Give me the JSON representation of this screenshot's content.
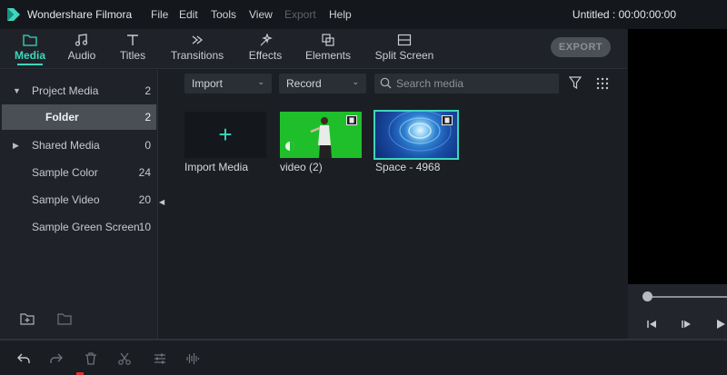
{
  "app": {
    "name": "Wondershare Filmora",
    "project_title": "Untitled : 00:00:00:00"
  },
  "menu": [
    {
      "label": "File",
      "enabled": true
    },
    {
      "label": "Edit",
      "enabled": true
    },
    {
      "label": "Tools",
      "enabled": true
    },
    {
      "label": "View",
      "enabled": true
    },
    {
      "label": "Export",
      "enabled": false
    },
    {
      "label": "Help",
      "enabled": true
    }
  ],
  "tabs": [
    {
      "label": "Media",
      "icon": "folder-icon",
      "active": true
    },
    {
      "label": "Audio",
      "icon": "music-note-icon",
      "active": false
    },
    {
      "label": "Titles",
      "icon": "text-icon",
      "active": false
    },
    {
      "label": "Transitions",
      "icon": "transition-icon",
      "active": false
    },
    {
      "label": "Effects",
      "icon": "effects-icon",
      "active": false
    },
    {
      "label": "Elements",
      "icon": "elements-icon",
      "active": false
    },
    {
      "label": "Split Screen",
      "icon": "split-screen-icon",
      "active": false
    }
  ],
  "export_label": "EXPORT",
  "library": [
    {
      "label": "Project Media",
      "count": "2",
      "caret": "▼"
    },
    {
      "label": "Folder",
      "count": "2",
      "caret": ""
    },
    {
      "label": "Shared Media",
      "count": "0",
      "caret": "▶"
    },
    {
      "label": "Sample Color",
      "count": "24",
      "caret": ""
    },
    {
      "label": "Sample Video",
      "count": "20",
      "caret": ""
    },
    {
      "label": "Sample Green Screen",
      "count": "10",
      "caret": ""
    }
  ],
  "media_toolbar": {
    "import_label": "Import",
    "record_label": "Record",
    "search_placeholder": "Search media"
  },
  "media_items": [
    {
      "label": "Import Media"
    },
    {
      "label": "video (2)"
    },
    {
      "label": "Space - 4968"
    }
  ],
  "colors": {
    "accent": "#3fd6bd",
    "background": "#1b1f24",
    "green_screen": "#1fbf2b"
  }
}
